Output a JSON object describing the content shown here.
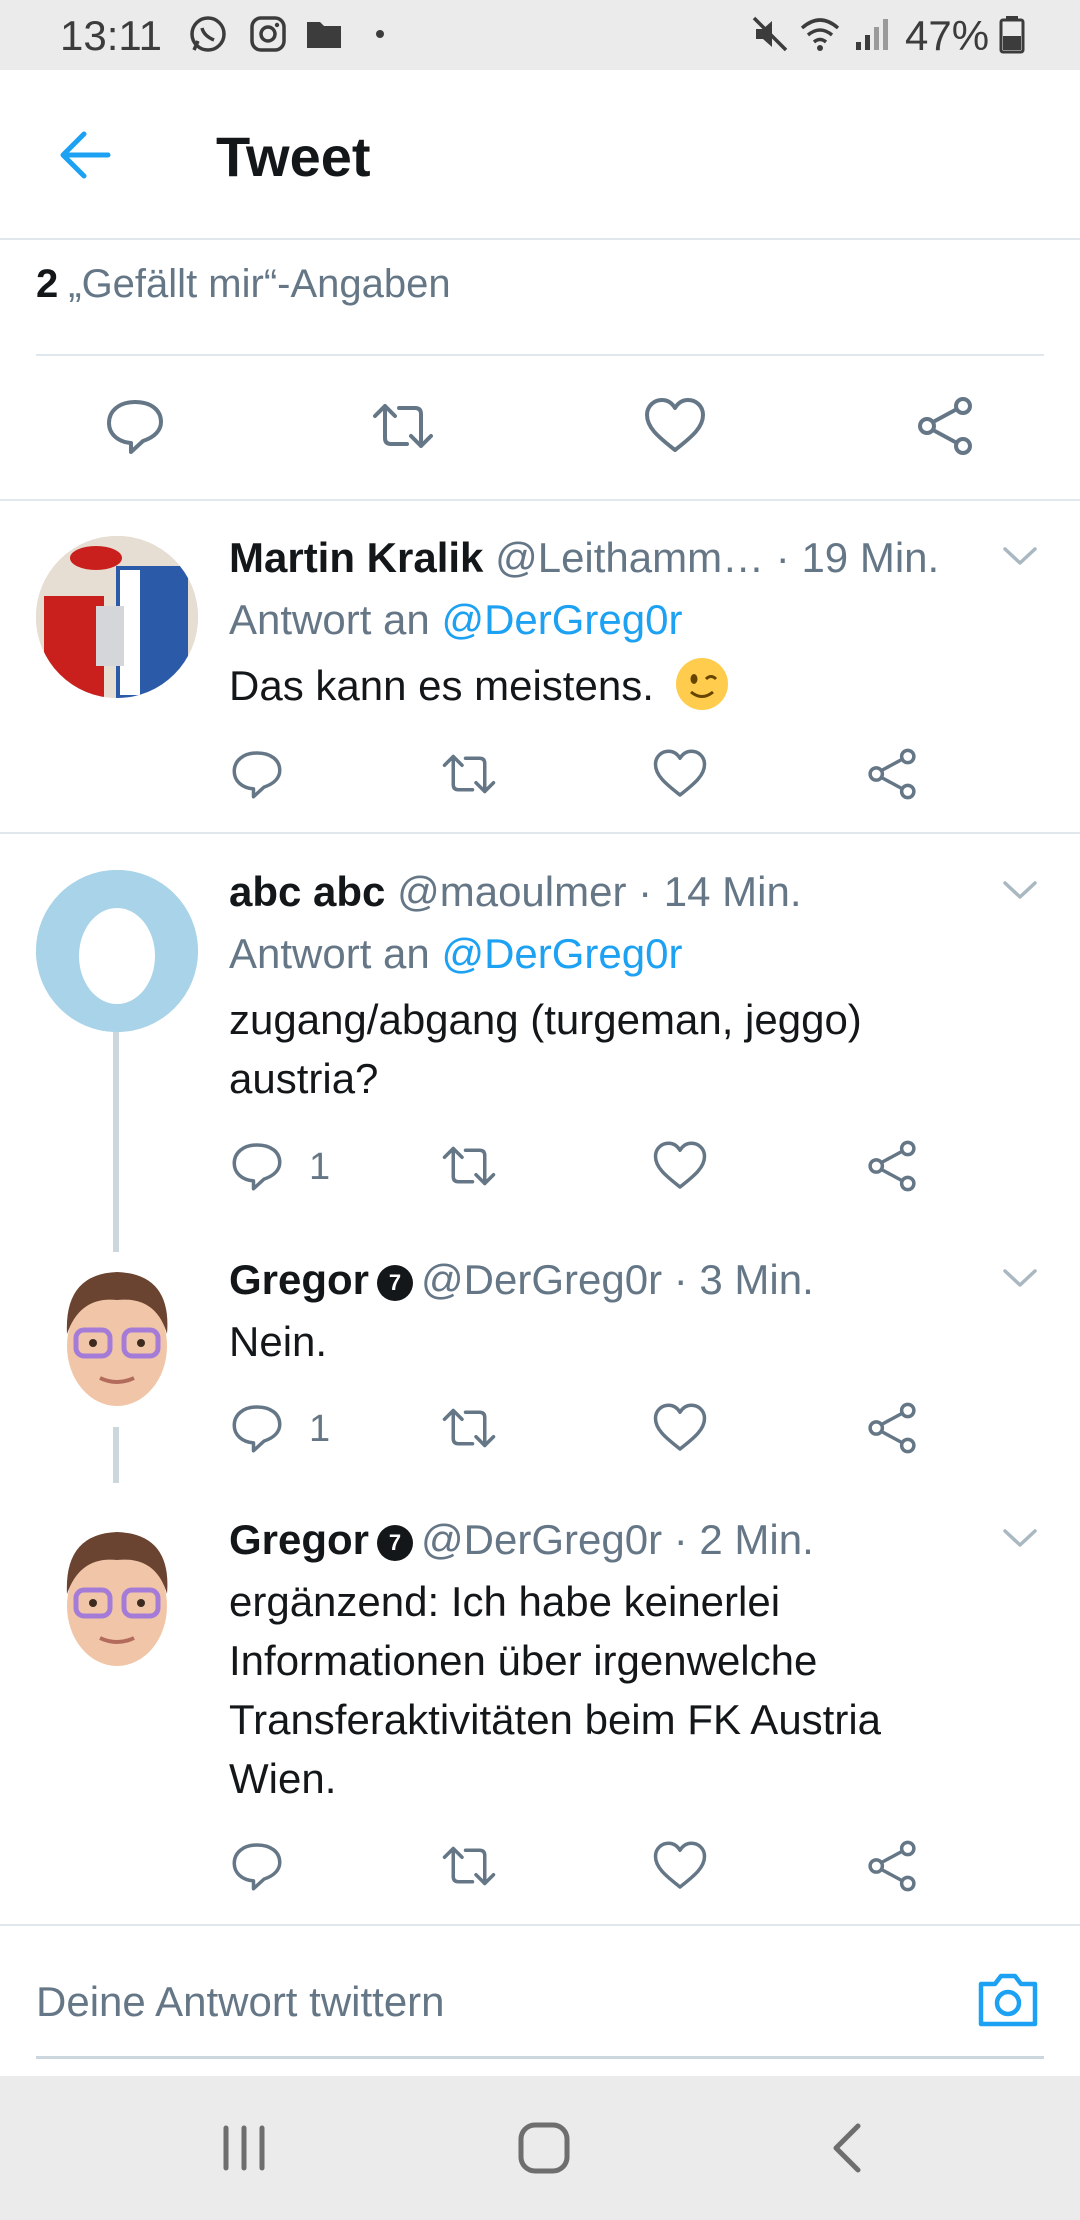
{
  "status_bar": {
    "time": "13:11",
    "battery": "47%",
    "icons": [
      "whatsapp-icon",
      "instagram-icon",
      "folder-icon",
      "mute-icon",
      "wifi-icon",
      "signal-icon",
      "battery-icon"
    ]
  },
  "header": {
    "title": "Tweet"
  },
  "likes": {
    "count": "2",
    "label": "„Gefällt mir“-Angaben"
  },
  "tweets": [
    {
      "name": "Martin Kralik",
      "handle": "@Leithamm…",
      "time": "· 19 Min.",
      "reply_prefix": "Antwort an",
      "reply_to": "@DerGreg0r",
      "text": "Das kann es meistens.",
      "reply_count": ""
    },
    {
      "name": "abc abc",
      "handle": "@maoulmer",
      "time": "· 14 Min.",
      "reply_prefix": "Antwort an",
      "reply_to": "@DerGreg0r",
      "text": "zugang/abgang (turgeman, jeggo) austria?",
      "reply_count": "1"
    },
    {
      "name": "Gregor",
      "badge": "7",
      "handle": "@DerGreg0r",
      "time": "· 3 Min.",
      "text": "Nein.",
      "reply_count": "1"
    },
    {
      "name": "Gregor",
      "badge": "7",
      "handle": "@DerGreg0r",
      "time": "· 2 Min.",
      "text": "ergänzend: Ich habe keinerlei Informationen über irgenwelche Transferaktivitäten beim FK Austria Wien.",
      "reply_count": ""
    }
  ],
  "composer": {
    "placeholder": "Deine Antwort twittern"
  },
  "colors": {
    "accent": "#1da1f2",
    "text": "#14171a",
    "secondary": "#657786",
    "divider": "#e1e8ed"
  }
}
